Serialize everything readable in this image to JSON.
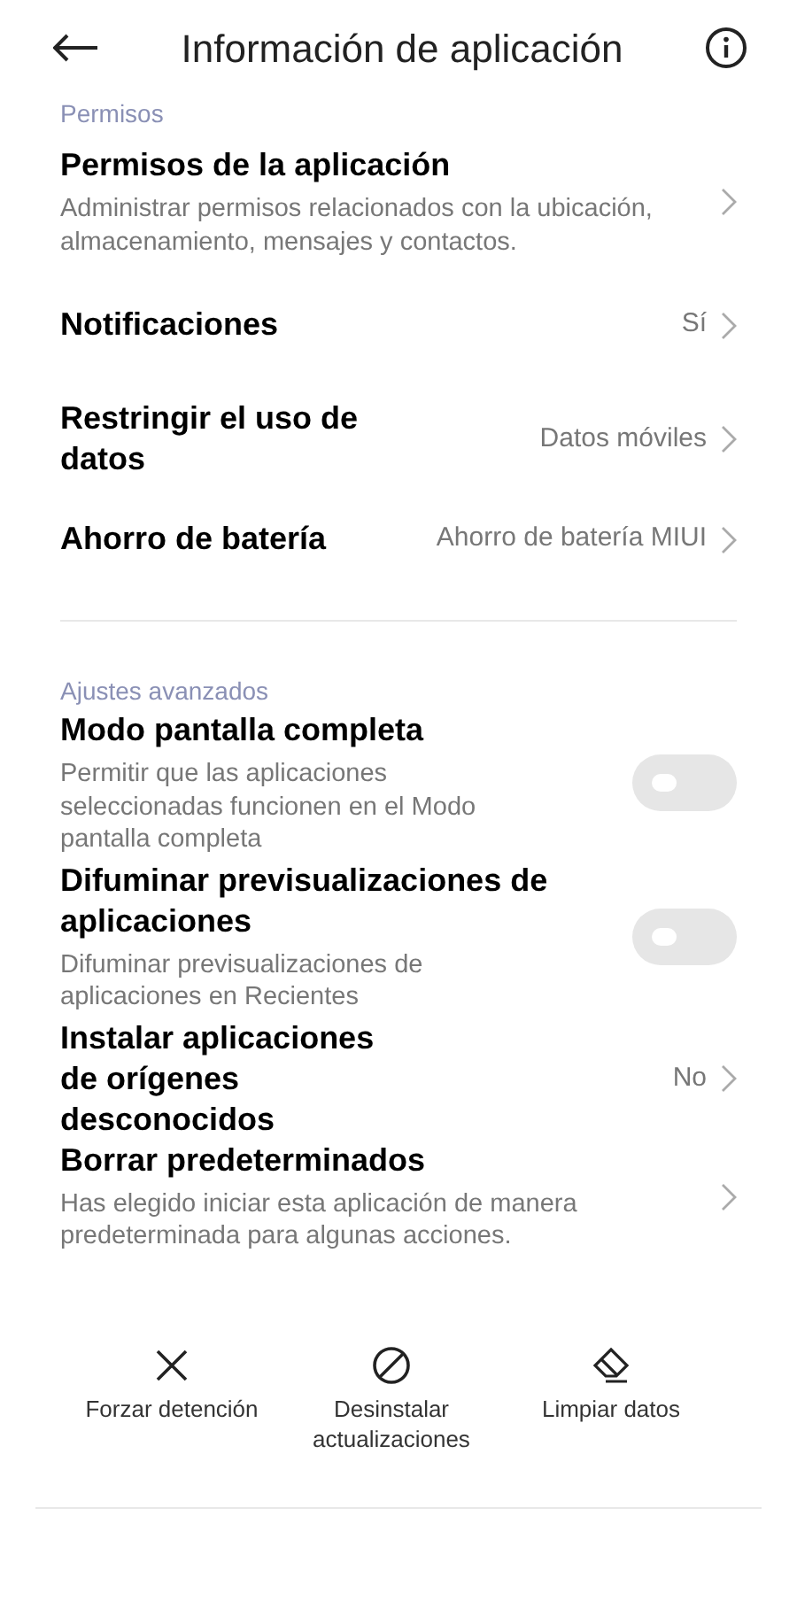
{
  "header": {
    "title": "Información de aplicación"
  },
  "sections": [
    {
      "label": "Permisos",
      "items": [
        {
          "kind": "nav",
          "title": "Permisos de la aplicación",
          "description": "Administrar permisos relacionados con la ubicación, almacenamiento, mensajes y contactos."
        },
        {
          "kind": "nav",
          "title": "Notificaciones",
          "value": "Sí"
        },
        {
          "kind": "nav",
          "title": "Restringir el uso de datos",
          "value": "Datos móviles"
        },
        {
          "kind": "nav",
          "title": "Ahorro de batería",
          "value": "Ahorro de batería MIUI"
        }
      ]
    },
    {
      "label": "Ajustes avanzados",
      "items": [
        {
          "kind": "toggle",
          "title": "Modo pantalla completa",
          "description": "Permitir que las aplicaciones seleccionadas funcionen en el Modo pantalla completa",
          "on": false
        },
        {
          "kind": "toggle",
          "title": "Difuminar previsualizaciones de aplicaciones",
          "description": "Difuminar previsualizaciones de aplicaciones en Recientes",
          "on": false
        },
        {
          "kind": "nav",
          "title": "Instalar aplicaciones de orígenes desconocidos",
          "value": "No"
        },
        {
          "kind": "nav",
          "title": "Borrar predeterminados",
          "description": "Has elegido iniciar esta aplicación de manera predeterminada para algunas acciones."
        }
      ]
    }
  ],
  "actions": [
    {
      "kind": "stop",
      "label": "Forzar detención"
    },
    {
      "kind": "uninstall",
      "label": "Desinstalar actualizaciones"
    },
    {
      "kind": "clear",
      "label": "Limpiar datos"
    }
  ]
}
